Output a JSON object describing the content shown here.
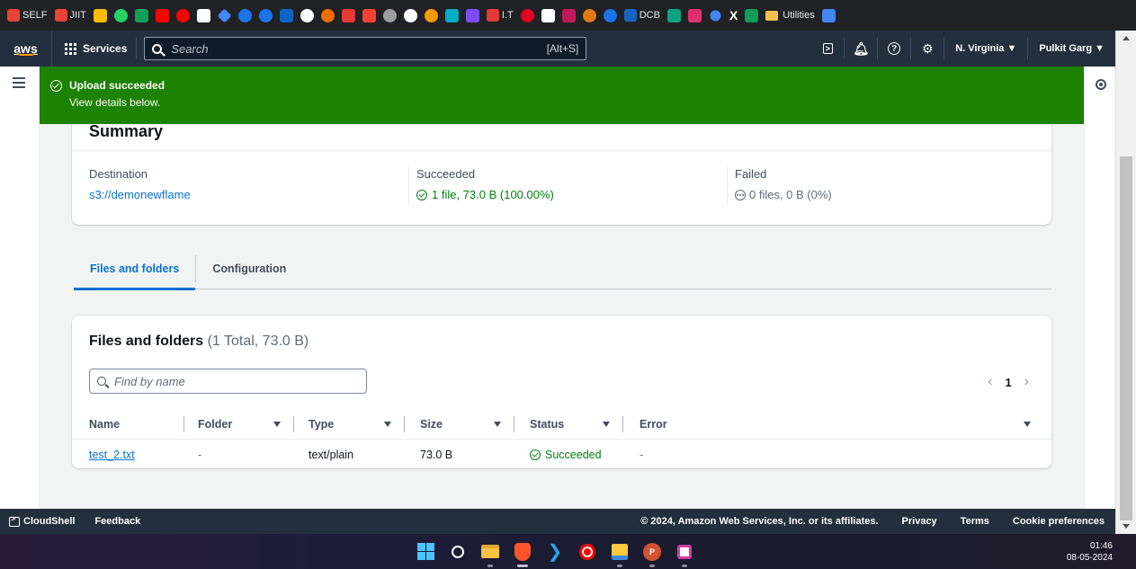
{
  "bookmarks": {
    "items": [
      {
        "label": "SELF",
        "icon": "gmail-icon",
        "color": "#ea4335"
      },
      {
        "label": "JIIT",
        "icon": "gmail-icon",
        "color": "#ea4335"
      },
      {
        "label": "",
        "icon": "google-drive-icon",
        "color": "#fbbc04"
      },
      {
        "label": "",
        "icon": "whatsapp-icon",
        "color": "#25d366"
      },
      {
        "label": "",
        "icon": "sheets-icon",
        "color": "#0f9d58"
      },
      {
        "label": "",
        "icon": "youtube-icon",
        "color": "#ff0000"
      },
      {
        "label": "",
        "icon": "youtube-music-icon",
        "color": "#ff0000"
      },
      {
        "label": "",
        "icon": "amazon-icon",
        "color": "#ffffff"
      },
      {
        "label": "",
        "icon": "diamond-icon",
        "color": "#4285f4"
      },
      {
        "label": "",
        "icon": "play-icon",
        "color": "#1a73e8"
      },
      {
        "label": "",
        "icon": "bookmark-icon",
        "color": "#1a73e8"
      },
      {
        "label": "",
        "icon": "linkedin-icon",
        "color": "#0a66c2"
      },
      {
        "label": "",
        "icon": "github-icon",
        "color": "#ffffff"
      },
      {
        "label": "",
        "icon": "record-icon",
        "color": "#ef6c00"
      },
      {
        "label": "",
        "icon": "codechef-icon",
        "color": "#e53935"
      },
      {
        "label": "",
        "icon": "codeforces-icon",
        "color": "#f44336"
      },
      {
        "label": "",
        "icon": "gear-icon",
        "color": "#9e9e9e"
      },
      {
        "label": "",
        "icon": "tool-icon",
        "color": "#ffffff"
      },
      {
        "label": "",
        "icon": "circle-icon",
        "color": "#ff9800"
      },
      {
        "label": "",
        "icon": "screen-icon",
        "color": "#00acc1"
      },
      {
        "label": "",
        "icon": "dub-icon",
        "color": "#7c4dff"
      },
      {
        "label": "I.T",
        "icon": "java-icon",
        "color": "#e53935"
      },
      {
        "label": "",
        "icon": "pinterest-icon",
        "color": "#e60023"
      },
      {
        "label": "",
        "icon": "notion-icon",
        "color": "#ffffff"
      },
      {
        "label": "",
        "icon": "email-icon",
        "color": "#c2185b"
      },
      {
        "label": "",
        "icon": "java-cup-icon",
        "color": "#e07a10"
      },
      {
        "label": "",
        "icon": "c-icon",
        "color": "#1a73e8"
      },
      {
        "label": "DCB",
        "icon": "dcb-icon",
        "color": "#1565c0"
      },
      {
        "label": "",
        "icon": "openai-icon",
        "color": "#10a37f"
      },
      {
        "label": "",
        "icon": "instagram-icon",
        "color": "#e1306c"
      },
      {
        "label": "",
        "icon": "gemini-icon",
        "color": "#4285f4"
      },
      {
        "label": "",
        "icon": "x-icon",
        "color": "#ffffff"
      },
      {
        "label": "",
        "icon": "sheet-icon",
        "color": "#0f9d58"
      },
      {
        "label": "Utilities",
        "icon": "folder-icon",
        "color": "#f0c24b"
      },
      {
        "label": "",
        "icon": "docs-icon",
        "color": "#4285f4"
      }
    ]
  },
  "topnav": {
    "logo": "aws",
    "services_label": "Services",
    "search_placeholder": "Search",
    "search_shortcut": "[Alt+S]",
    "region": "N. Virginia ▼",
    "user": "Pulkit Garg ▼"
  },
  "flash": {
    "title": "Upload succeeded",
    "subtitle": "View details below.",
    "color": "#1d8102"
  },
  "summary": {
    "heading": "Summary",
    "destination_label": "Destination",
    "destination_value": "s3://demonewflame",
    "succeeded_label": "Succeeded",
    "succeeded_value": "1 file, 73.0 B (100.00%)",
    "failed_label": "Failed",
    "failed_value": "0 files, 0 B (0%)"
  },
  "tabs": [
    {
      "label": "Files and folders",
      "active": true
    },
    {
      "label": "Configuration",
      "active": false
    }
  ],
  "files": {
    "title": "Files and folders",
    "count": "(1 Total, 73.0 B)",
    "filter_placeholder": "Find by name",
    "page": "1",
    "columns": [
      "Name",
      "Folder",
      "Type",
      "Size",
      "Status",
      "Error"
    ],
    "rows": [
      {
        "name": "test_2.txt",
        "folder": "-",
        "type": "text/plain",
        "size": "73.0 B",
        "status": "Succeeded",
        "error": "-"
      }
    ]
  },
  "footer": {
    "cloudshell": "CloudShell",
    "feedback": "Feedback",
    "copyright": "© 2024, Amazon Web Services, Inc. or its affiliates.",
    "privacy": "Privacy",
    "terms": "Terms",
    "cookies": "Cookie preferences"
  },
  "taskbar": {
    "time": "01:46",
    "date": "08-05-2024",
    "apps": [
      "windows-start-icon",
      "search-icon",
      "file-explorer-icon",
      "brave-icon",
      "vscode-icon",
      "youtube-music-icon",
      "sticky-notes-icon",
      "powerpoint-icon",
      "snipping-tool-icon"
    ]
  },
  "colors": {
    "aws_nav": "#232f3e",
    "link": "#0972d3",
    "success": "#037f0c",
    "accent": "#ff9900"
  }
}
